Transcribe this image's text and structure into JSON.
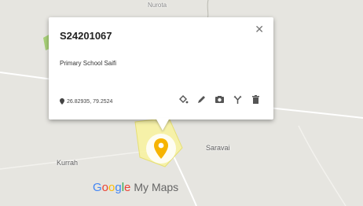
{
  "map": {
    "place_labels": {
      "top": "Nurota",
      "saravai": "Saravai",
      "kurrah": "Kurrah"
    },
    "colors": {
      "land": "#e6e5e0",
      "road": "#ffffff",
      "highlight_area": "#f8f3a3",
      "green_area": "#9ccc65",
      "marker": "#f6b400"
    }
  },
  "popup": {
    "title": "S24201067",
    "description": "Primary School Saifi",
    "coordinates": "26.82935, 79.2524",
    "close_icon": "close-icon",
    "toolbar_icons": [
      "paint-bucket-icon",
      "pencil-icon",
      "camera-icon",
      "directions-icon",
      "trash-icon"
    ]
  },
  "watermark": {
    "google_letters": [
      "G",
      "o",
      "o",
      "g",
      "l",
      "e"
    ],
    "suffix": "My Maps"
  }
}
